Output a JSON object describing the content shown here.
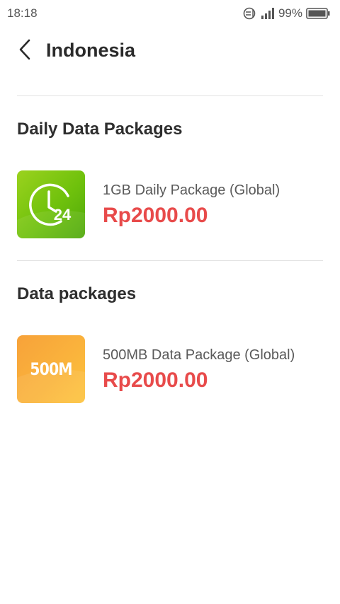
{
  "status_bar": {
    "time": "18:18",
    "battery": "99%"
  },
  "header": {
    "title": "Indonesia"
  },
  "sections": [
    {
      "title": "Daily Data Packages",
      "package": {
        "name": "1GB Daily Package (Global)",
        "price": "Rp2000.00",
        "icon": "clock-24-icon",
        "icon_text": "24"
      }
    },
    {
      "title": "Data packages",
      "package": {
        "name": "500MB Data Package (Global)",
        "price": "Rp2000.00",
        "icon": "500m-icon",
        "icon_text": "500M"
      }
    }
  ],
  "colors": {
    "price": "#e84b4b",
    "daily_icon": "#7cc714",
    "data_icon": "#fab33c"
  }
}
